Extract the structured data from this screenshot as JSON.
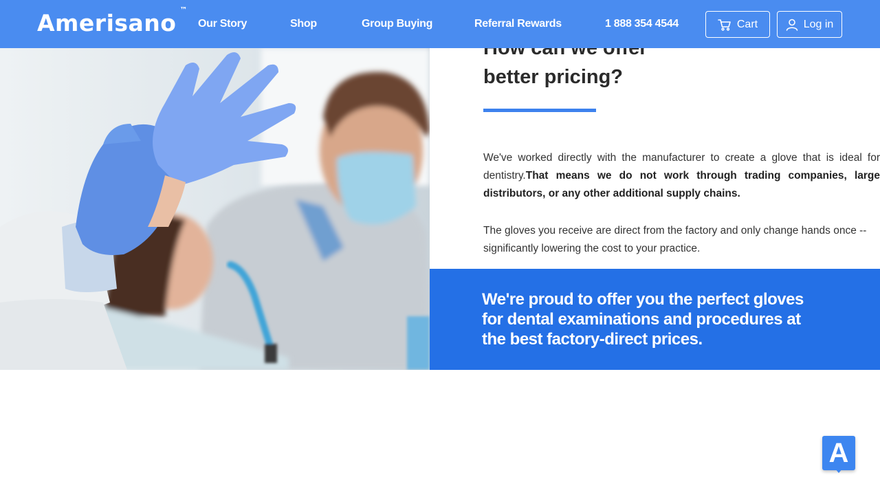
{
  "header": {
    "logo": "Amerisano",
    "logo_tm": "™",
    "nav": [
      "Our Story",
      "Shop",
      "Group Buying",
      "Referral Rewards",
      "1 888 354 4544"
    ],
    "cart_label": "Cart",
    "login_label": "Log in"
  },
  "main": {
    "heading_line1": "How can we offer",
    "heading_line2": "better pricing?",
    "para1_normal": "We've worked directly with the manufacturer to create a glove that is ideal for dentistry.",
    "para1_bold": "That means we do not work through trading companies, large distributors, or any other additional supply chains.",
    "para2": "The gloves you receive are direct from the factory and only change hands once -- significantly lowering the cost to your practice.",
    "banner": "We're proud to offer you the perfect gloves for dental examinations and procedures at the best factory-direct prices."
  },
  "widget": {
    "label": "A"
  },
  "icons": {
    "cart": "cart-icon",
    "user": "user-icon",
    "widget": "accessibility-widget-icon"
  },
  "colors": {
    "header": "#4a8cf0",
    "accent": "#3d82ee",
    "banner": "#2470e6"
  }
}
